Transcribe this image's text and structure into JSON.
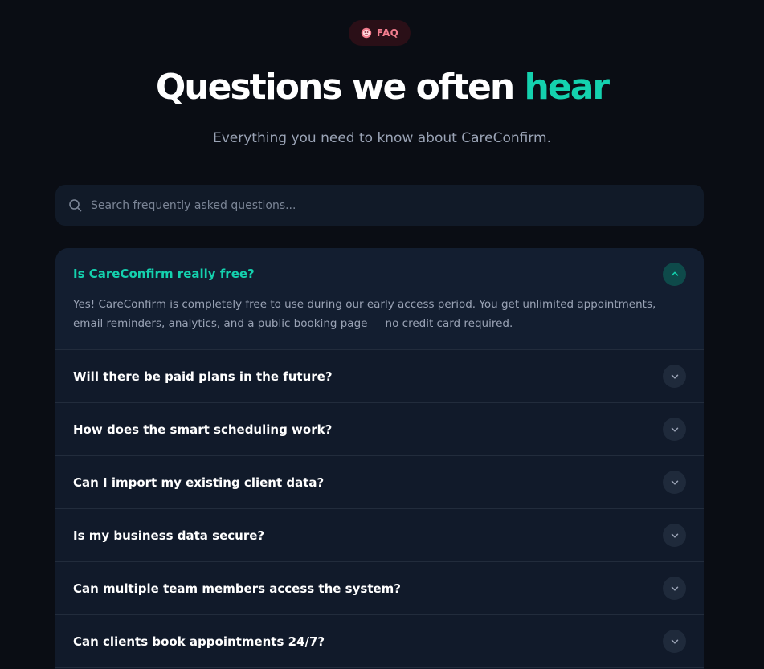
{
  "badge": {
    "label": "FAQ",
    "icon": "badge-emoji-icon"
  },
  "heading": {
    "title_main": "Questions we often",
    "title_accent": "hear",
    "subtitle": "Everything you need to know about CareConfirm."
  },
  "search": {
    "placeholder": "Search frequently asked questions...",
    "value": ""
  },
  "faq": {
    "items": [
      {
        "question": "Is CareConfirm really free?",
        "answer": "Yes! CareConfirm is completely free to use during our early access period. You get unlimited appointments, email reminders, analytics, and a public booking page — no credit card required.",
        "expanded": true
      },
      {
        "question": "Will there be paid plans in the future?",
        "expanded": false
      },
      {
        "question": "How does the smart scheduling work?",
        "expanded": false
      },
      {
        "question": "Can I import my existing client data?",
        "expanded": false
      },
      {
        "question": "Is my business data secure?",
        "expanded": false
      },
      {
        "question": "Can multiple team members access the system?",
        "expanded": false
      },
      {
        "question": "Can clients book appointments 24/7?",
        "expanded": false
      }
    ]
  },
  "colors": {
    "background": "#0a0d14",
    "accent": "#14d1ae",
    "badge_text": "#f27d8e",
    "panel": "#111a2a",
    "muted_text": "#9aa3b5"
  }
}
